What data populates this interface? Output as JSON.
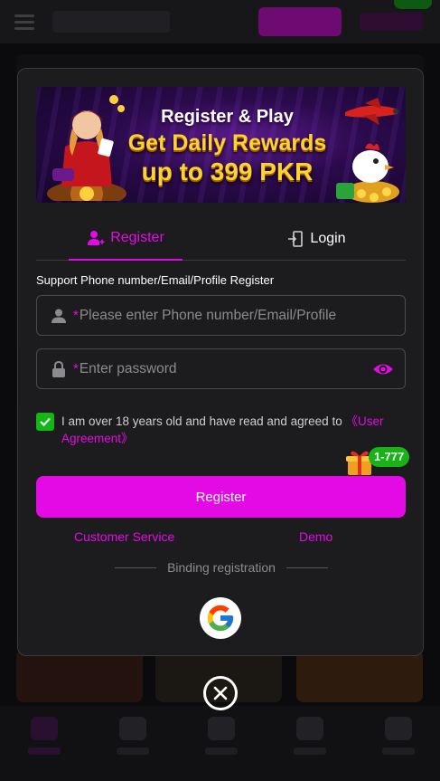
{
  "banner": {
    "line1": "Register & Play",
    "line2": "Get Daily Rewards",
    "line3": "up to 399 PKR"
  },
  "tabs": {
    "register": "Register",
    "login": "Login"
  },
  "form": {
    "support_text": "Support Phone number/Email/Profile Register",
    "required_mark": "*",
    "phone_placeholder": "Please enter Phone number/Email/Profile",
    "password_placeholder": "Enter password"
  },
  "agreement": {
    "text": "I am over 18 years old and have read and agreed to ",
    "link": "《User Agreement》",
    "checked": true
  },
  "bonus_badge": "1-777",
  "register_button": "Register",
  "links": {
    "customer_service": "Customer Service",
    "demo": "Demo"
  },
  "binding_label": "Binding registration",
  "colors": {
    "accent": "#e40ae6",
    "check_green": "#14b814",
    "modal_bg": "#1c1c1e"
  },
  "icons": {
    "register_tab": "add-user-icon",
    "login_tab": "login-door-icon",
    "phone_field": "user-icon",
    "password_field": "lock-icon",
    "password_toggle": "eye-icon",
    "checkbox": "checkmark-icon",
    "gift": "gift-icon",
    "google": "google-icon",
    "close": "close-icon"
  }
}
